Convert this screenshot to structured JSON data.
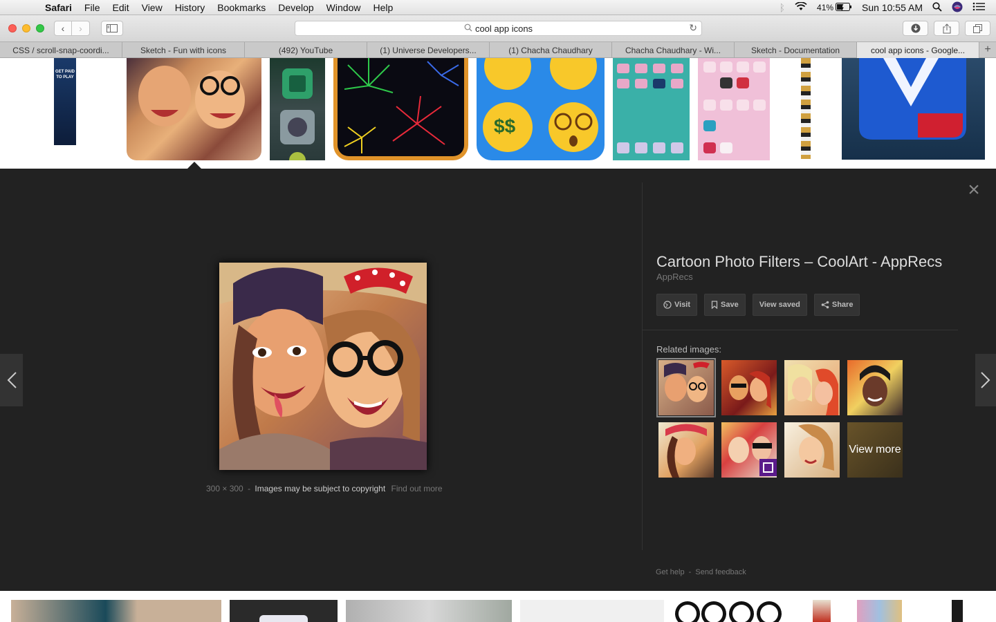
{
  "menubar": {
    "apple_icon": "apple-icon",
    "app": "Safari",
    "items": [
      "File",
      "Edit",
      "View",
      "History",
      "Bookmarks",
      "Develop",
      "Window",
      "Help"
    ],
    "battery": "41%",
    "clock": "Sun 10:55 AM"
  },
  "toolbar": {
    "address": "cool app icons"
  },
  "tabs": [
    "CSS / scroll-snap-coordi...",
    "Sketch - Fun with icons",
    "(492) YouTube",
    "(1) Universe Developers...",
    "(1) Chacha Chaudhary",
    "Chacha Chaudhary - Wi...",
    "Sketch - Documentation",
    "cool app icons - Google..."
  ],
  "strip": {
    "ad_text": "GET PAID TO PLAY"
  },
  "preview": {
    "dimensions": "300 × 300",
    "sep1": "-",
    "copyright": "Images may be subject to copyright",
    "find_out_more": "Find out more",
    "title": "Cartoon Photo Filters – CoolArt - AppRecs",
    "source": "AppRecs",
    "actions": {
      "visit": "Visit",
      "save": "Save",
      "view_saved": "View saved",
      "share": "Share"
    },
    "related_label": "Related images:",
    "view_more": "View more",
    "footer_help": "Get help",
    "footer_sep": "-",
    "footer_feedback": "Send feedback"
  },
  "colors": {
    "panel_bg": "#222222",
    "traffic_red": "#fc5f57",
    "traffic_yellow": "#fdbc2e",
    "traffic_green": "#33c748"
  }
}
